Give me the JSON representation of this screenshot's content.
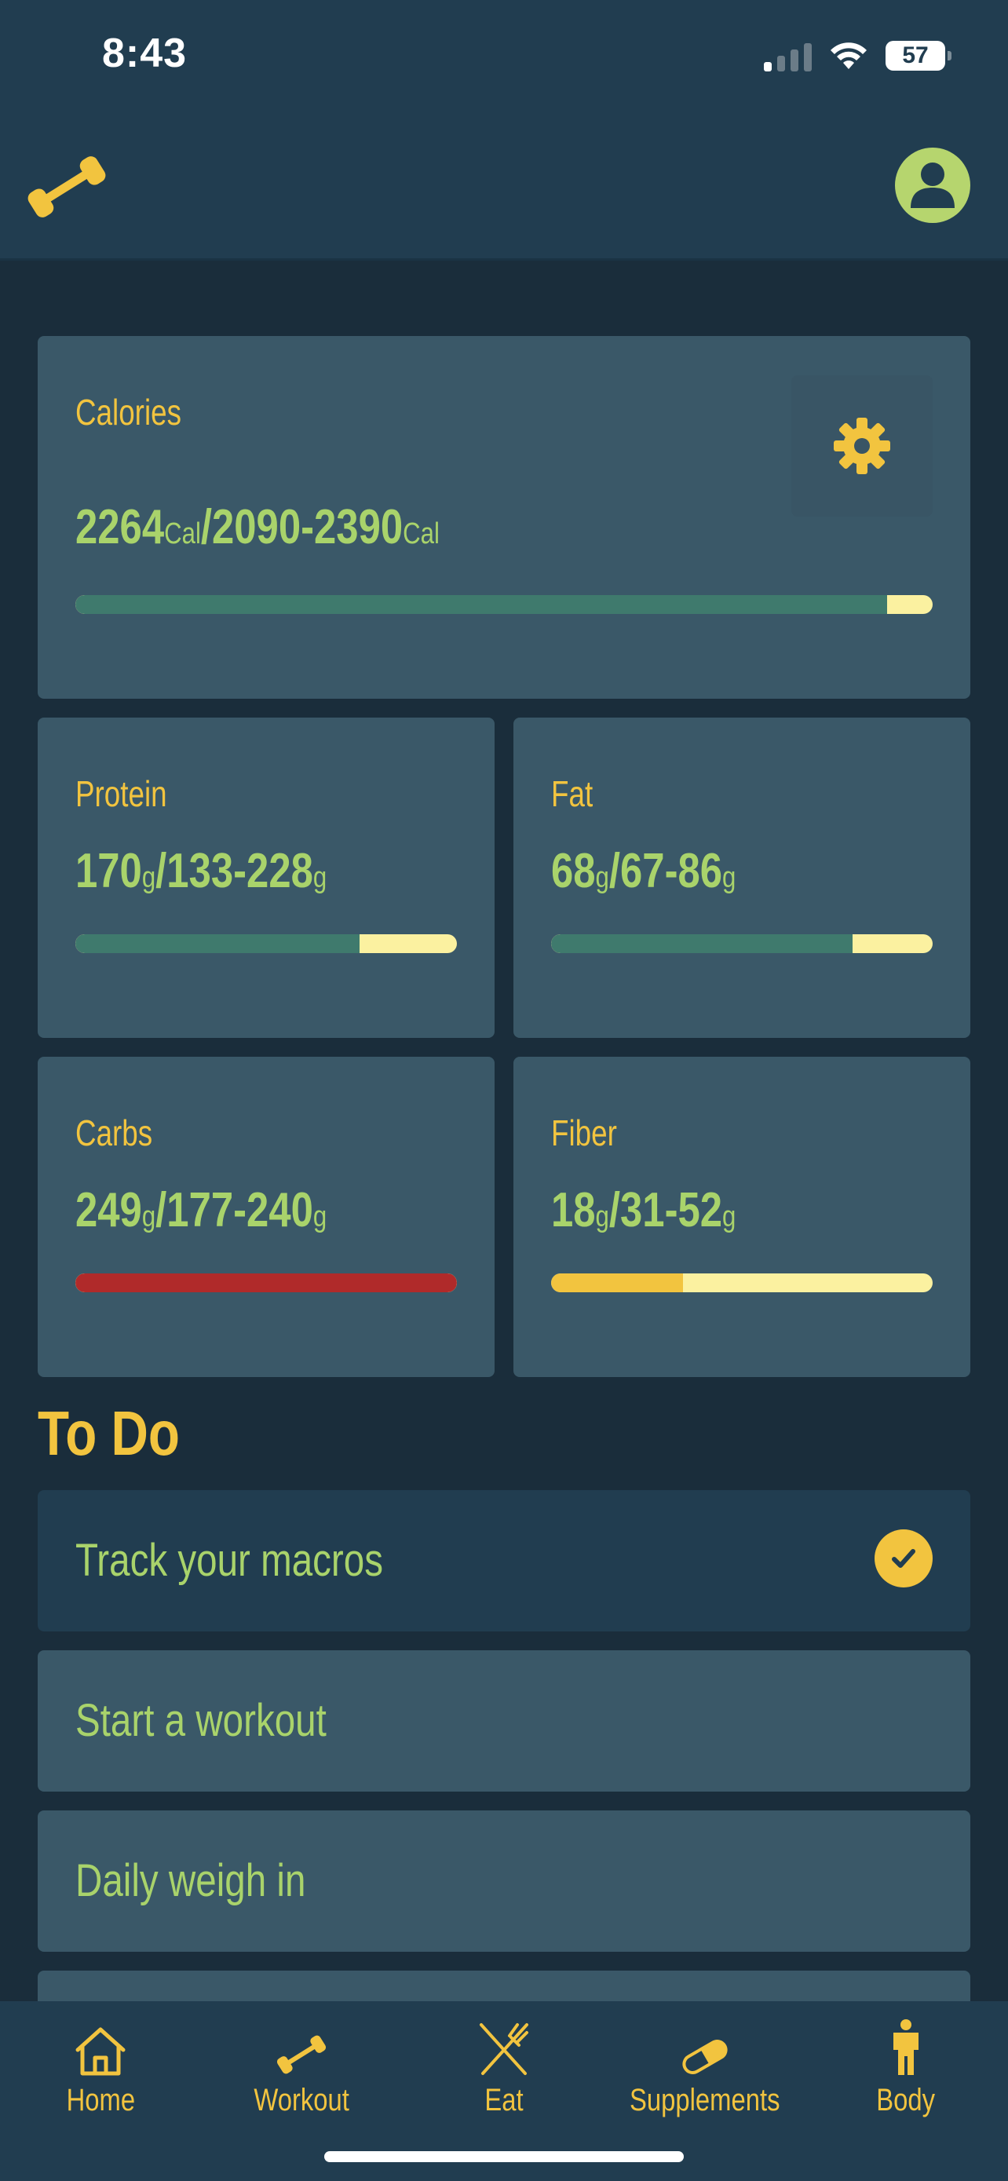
{
  "status": {
    "time": "8:43",
    "battery": "57"
  },
  "header": {
    "logo_icon": "dumbbell-icon",
    "profile_icon": "person-icon"
  },
  "colors": {
    "accent_yellow": "#f2c43f",
    "value_green": "#a9d36b",
    "progress_teal": "#3f7a6d",
    "progress_track": "#fbf1a0",
    "over_red": "#b02a2a",
    "under_yellow": "#f2c43f"
  },
  "macros": {
    "calories": {
      "title": "Calories",
      "value": "2264",
      "unit": "Cal",
      "range": "2090-2390",
      "range_unit": "Cal",
      "progress": 0.947,
      "status": "ok",
      "settings_icon": "gear-icon"
    },
    "protein": {
      "title": "Protein",
      "value": "170",
      "unit": "g",
      "range": "133-228",
      "range_unit": "g",
      "progress": 0.745,
      "status": "ok"
    },
    "fat": {
      "title": "Fat",
      "value": "68",
      "unit": "g",
      "range": "67-86",
      "range_unit": "g",
      "progress": 0.79,
      "status": "ok"
    },
    "carbs": {
      "title": "Carbs",
      "value": "249",
      "unit": "g",
      "range": "177-240",
      "range_unit": "g",
      "progress": 1.0,
      "status": "over"
    },
    "fiber": {
      "title": "Fiber",
      "value": "18",
      "unit": "g",
      "range": "31-52",
      "range_unit": "g",
      "progress": 0.346,
      "status": "under"
    }
  },
  "todo": {
    "title": "To Do",
    "items": [
      {
        "label": "Track your macros",
        "done": true
      },
      {
        "label": "Start a workout",
        "done": false
      },
      {
        "label": "Daily weigh in",
        "done": false
      }
    ]
  },
  "tabs": [
    {
      "label": "Home",
      "icon": "home-icon"
    },
    {
      "label": "Workout",
      "icon": "dumbbell-icon"
    },
    {
      "label": "Eat",
      "icon": "fork-knife-icon"
    },
    {
      "label": "Supplements",
      "icon": "pill-icon"
    },
    {
      "label": "Body",
      "icon": "person-standing-icon"
    }
  ]
}
